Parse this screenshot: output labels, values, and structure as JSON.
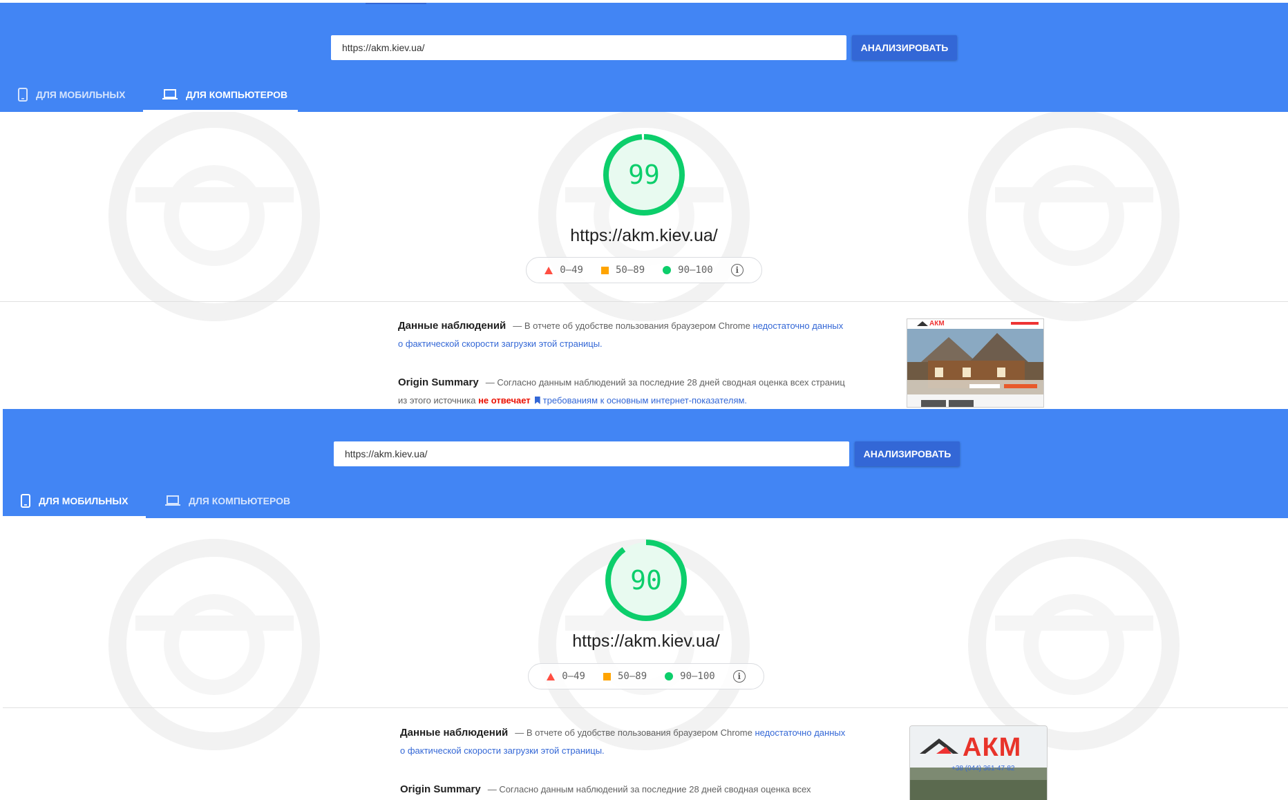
{
  "desktop_view": {
    "url_input_value": "https://akm.kiev.ua/",
    "analyze_button": "АНАЛИЗИРОВАТЬ",
    "tabs": [
      {
        "label": "ДЛЯ МОБИЛЬНЫХ",
        "icon": "phone-icon",
        "active": false
      },
      {
        "label": "ДЛЯ КОМПЬЮТЕРОВ",
        "icon": "laptop-icon",
        "active": true
      }
    ],
    "score": "99",
    "score_fraction": 0.99,
    "tested_url": "https://akm.kiev.ua/",
    "legend": {
      "fail": "0–49",
      "average": "50–89",
      "pass": "90–100"
    },
    "field_data": {
      "title": "Данные наблюдений",
      "text": "— В отчете об удобстве пользования браузером Chrome ",
      "link": "недостаточно данных о фактической скорости загрузки этой страницы."
    },
    "origin_summary": {
      "title": "Origin Summary",
      "text": "— Согласно данным наблюдений за последние 28 дней сводная оценка всех страниц из этого источника ",
      "status": "не отвечает",
      "link": "требованиям к основным интернет-показателям."
    },
    "thumbnail_logo": "АКМ"
  },
  "mobile_view": {
    "url_input_value": "https://akm.kiev.ua/",
    "analyze_button": "АНАЛИЗИРОВАТЬ",
    "tabs": [
      {
        "label": "ДЛЯ МОБИЛЬНЫХ",
        "icon": "phone-icon",
        "active": true
      },
      {
        "label": "ДЛЯ КОМПЬЮТЕРОВ",
        "icon": "laptop-icon",
        "active": false
      }
    ],
    "score": "90",
    "score_fraction": 0.9,
    "tested_url": "https://akm.kiev.ua/",
    "legend": {
      "fail": "0–49",
      "average": "50–89",
      "pass": "90–100"
    },
    "field_data": {
      "title": "Данные наблюдений",
      "text": "— В отчете об удобстве пользования браузером Chrome ",
      "link": "недостаточно данных о фактической скорости загрузки этой страницы."
    },
    "origin_summary": {
      "title": "Origin Summary",
      "text": "— Согласно данным наблюдений за последние 28 дней сводная оценка всех"
    },
    "thumbnail_logo": "АКМ",
    "thumbnail_phone": "+38 (044) 361-47-82"
  },
  "colors": {
    "header_blue": "#4285f4",
    "button_blue": "#3367d6",
    "pass_green": "#0cce6b",
    "average_orange": "#ffa400",
    "fail_red": "#ff4e42",
    "link_blue": "#3367d6",
    "fail_text": "#eb0f00"
  }
}
